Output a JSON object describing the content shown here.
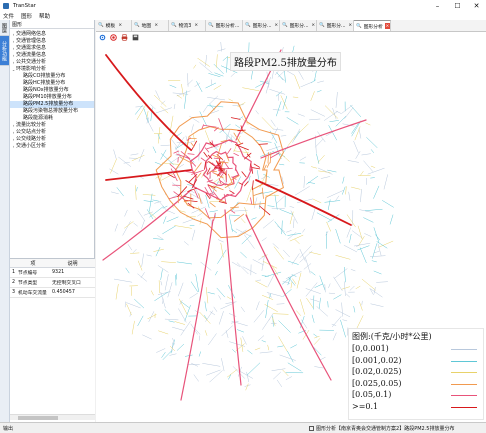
{
  "app": {
    "title": "TranStar"
  },
  "window": {
    "minimize": "–",
    "maximize": "☐",
    "close": "✕"
  },
  "menu": [
    "文件",
    "图形",
    "帮助"
  ],
  "vertical_tabs": [
    "图层",
    "分析功能"
  ],
  "tree": {
    "header": "图形",
    "items": [
      {
        "label": "交通网络信息",
        "level": 0,
        "toggle": "›",
        "selected": false
      },
      {
        "label": "交通管理信息",
        "level": 0,
        "toggle": "›",
        "selected": false
      },
      {
        "label": "交通需求信息",
        "level": 0,
        "toggle": "›",
        "selected": false
      },
      {
        "label": "交通流量信息",
        "level": 0,
        "toggle": "›",
        "selected": false
      },
      {
        "label": "公共交通分析",
        "level": 0,
        "toggle": "›",
        "selected": false
      },
      {
        "label": "环境影响分析",
        "level": 0,
        "toggle": "⌄",
        "selected": false
      },
      {
        "label": "路段CO排放量分布",
        "level": 1,
        "toggle": "",
        "selected": false
      },
      {
        "label": "路段HC排放量分布",
        "level": 1,
        "toggle": "",
        "selected": false
      },
      {
        "label": "路段NOx排放量分布",
        "level": 1,
        "toggle": "",
        "selected": false
      },
      {
        "label": "路段PM10排放量分布",
        "level": 1,
        "toggle": "",
        "selected": false
      },
      {
        "label": "路段PM2.5排放量分布",
        "level": 1,
        "toggle": "",
        "selected": true
      },
      {
        "label": "路段污染物总排放量分布",
        "level": 1,
        "toggle": "",
        "selected": false
      },
      {
        "label": "路段能源消耗",
        "level": 1,
        "toggle": "",
        "selected": false
      },
      {
        "label": "流量比较分析",
        "level": 0,
        "toggle": "›",
        "selected": false
      },
      {
        "label": "公交站点分析",
        "level": 0,
        "toggle": "›",
        "selected": false
      },
      {
        "label": "公交线路分析",
        "level": 0,
        "toggle": "›",
        "selected": false
      },
      {
        "label": "交通小区分析",
        "level": 0,
        "toggle": "›",
        "selected": false
      }
    ]
  },
  "properties": {
    "headers": [
      "项",
      "说明"
    ],
    "rows": [
      {
        "no": "1",
        "key": "节点编号",
        "value": "9321"
      },
      {
        "no": "2",
        "key": "节点类型",
        "value": "无控制交叉口"
      },
      {
        "no": "3",
        "key": "机动车交流量",
        "value": "0.450457"
      }
    ]
  },
  "tabs": [
    {
      "label": "模板",
      "active": false
    },
    {
      "label": "地图",
      "active": false
    },
    {
      "label": "物流3",
      "active": false
    },
    {
      "label": "图形分析...",
      "active": false
    },
    {
      "label": "图形分...",
      "active": false
    },
    {
      "label": "图形分...",
      "active": false
    },
    {
      "label": "图形分...",
      "active": false
    },
    {
      "label": "图形分析",
      "active": true
    }
  ],
  "map": {
    "title": "路段PM2.5排放量分布"
  },
  "legend": {
    "title": "图例:(千克/小时*公里)",
    "items": [
      {
        "label": "[0,0.001)",
        "color": "#b8c8dc"
      },
      {
        "label": "[0.001,0.02)",
        "color": "#5fc7d6"
      },
      {
        "label": "[0.02,0.025)",
        "color": "#e8d26a"
      },
      {
        "label": "[0.025,0.05)",
        "color": "#f19a4f"
      },
      {
        "label": "[0.05,0.1)",
        "color": "#e8537a"
      },
      {
        "label": ">=0.1",
        "color": "#d7191c"
      }
    ]
  },
  "status": {
    "left": "输出",
    "right": "图形分析【南京青奥会交通管制方案2】路段PM2.5排放量分布"
  }
}
